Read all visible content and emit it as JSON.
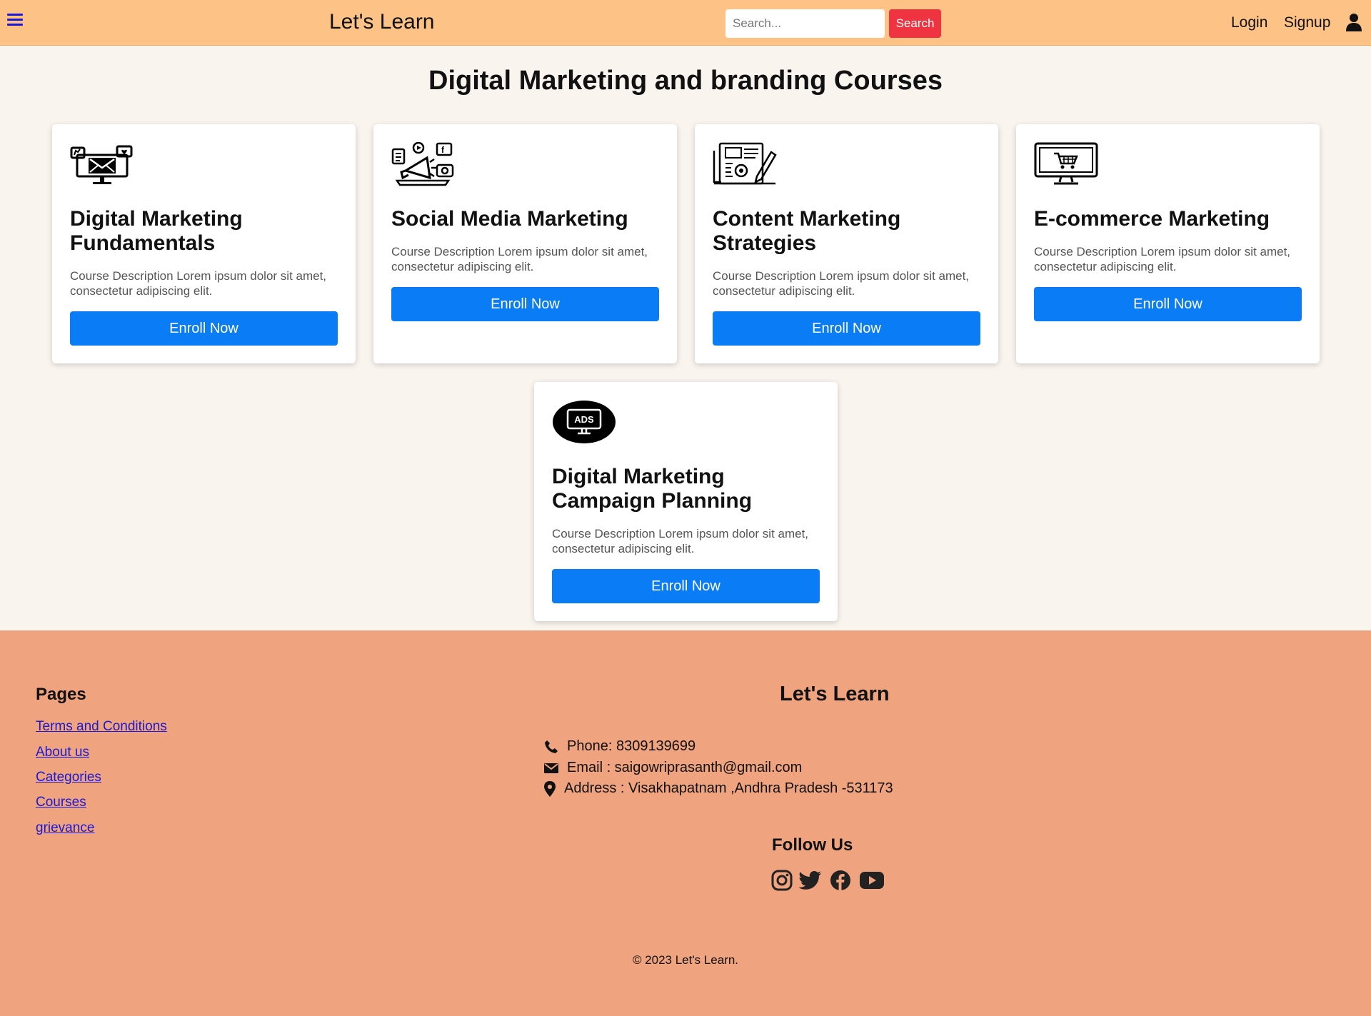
{
  "nav": {
    "brand": "Let's Learn",
    "search_placeholder": "Search...",
    "search_button": "Search",
    "login": "Login",
    "signup": "Signup"
  },
  "main": {
    "title": "Digital Marketing and branding Courses",
    "courses": [
      {
        "title": "Digital Marketing Fundamentals",
        "description": "Course Description Lorem ipsum dolor sit amet, consectetur adipiscing elit.",
        "button": "Enroll Now",
        "icon": "digital-marketing-monitor-icon"
      },
      {
        "title": "Social Media Marketing",
        "description": "Course Description Lorem ipsum dolor sit amet, consectetur adipiscing elit.",
        "button": "Enroll Now",
        "icon": "megaphone-social-icon"
      },
      {
        "title": "Content Marketing Strategies",
        "description": "Course Description Lorem ipsum dolor sit amet, consectetur adipiscing elit.",
        "button": "Enroll Now",
        "icon": "content-document-icon"
      },
      {
        "title": "E-commerce Marketing",
        "description": "Course Description Lorem ipsum dolor sit amet, consectetur adipiscing elit.",
        "button": "Enroll Now",
        "icon": "shopping-cart-monitor-icon"
      },
      {
        "title": "Digital Marketing Campaign Planning",
        "description": "Course Description Lorem ipsum dolor sit amet, consectetur adipiscing elit.",
        "button": "Enroll Now",
        "icon": "ads-monitor-icon"
      }
    ]
  },
  "footer": {
    "pages_title": "Pages",
    "links": [
      "Terms and Conditions",
      "About us",
      "Categories",
      "Courses",
      "grievance"
    ],
    "brand": "Let's Learn",
    "phone": "Phone: 8309139699",
    "email": "Email : saigowriprasanth@gmail.com",
    "address": "Address : Visakhapatnam ,Andhra Pradesh -531173",
    "follow_title": "Follow Us",
    "social": [
      "instagram-icon",
      "twitter-icon",
      "facebook-icon",
      "youtube-icon"
    ],
    "copyright": "© 2023 Let's Learn."
  }
}
